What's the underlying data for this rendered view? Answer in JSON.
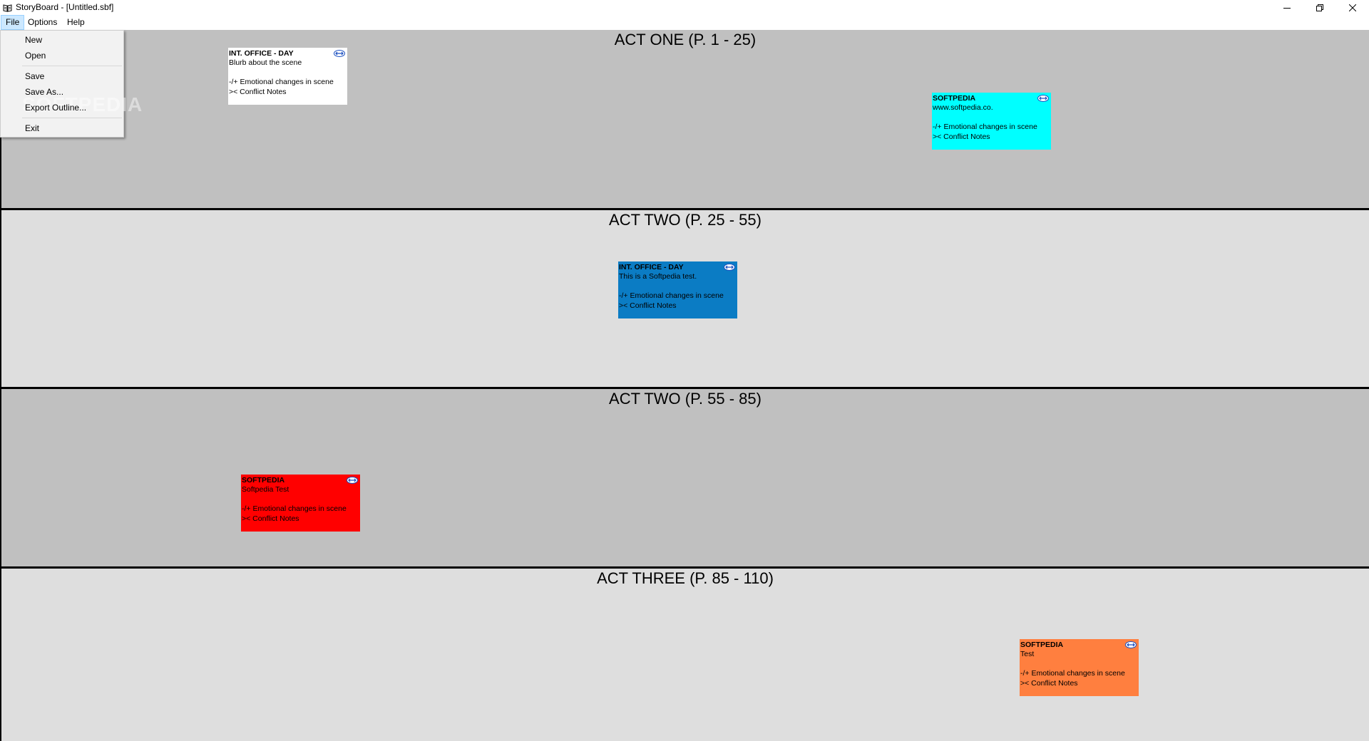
{
  "window": {
    "title": "StoryBoard - [Untitled.sbf]",
    "icon": "book-icon",
    "controls": [
      "minimize-icon",
      "restore-icon",
      "close-icon"
    ]
  },
  "menubar": {
    "file": "File",
    "options": "Options",
    "help": "Help"
  },
  "file_menu": {
    "open_state": "expanded",
    "watermark": "SOFTPEDIA",
    "items": [
      {
        "label": "New"
      },
      {
        "label": "Open"
      },
      {
        "label": "Save"
      },
      {
        "label": "Save As..."
      },
      {
        "label": "Export Outline..."
      },
      {
        "label": "Exit"
      }
    ]
  },
  "acts": [
    {
      "title": "ACT ONE (P. 1 - 25)",
      "shade": "#c0c0c0"
    },
    {
      "title": "ACT TWO (P. 25 - 55)",
      "shade": "#dedede"
    },
    {
      "title": "ACT TWO (P. 55 - 85)",
      "shade": "#c0c0c0"
    },
    {
      "title": "ACT THREE (P. 85 - 110)",
      "shade": "#dedede"
    }
  ],
  "cards": [
    {
      "heading": "INT. OFFICE - DAY",
      "text": "Blurb about the scene",
      "emotion": "-/+ Emotional changes in scene",
      "conflict": ">< Conflict Notes",
      "color": "#ffffff",
      "icon": "arrow-link-icon"
    },
    {
      "heading": "SOFTPEDIA",
      "text": "www.softpedia.co.",
      "emotion": "-/+ Emotional changes in scene",
      "conflict": ">< Conflict Notes",
      "color": "#00ffff",
      "icon": "arrow-link-icon"
    },
    {
      "heading": "INT. OFFICE - DAY",
      "text": "This is a Softpedia test.",
      "emotion": "-/+ Emotional changes in scene",
      "conflict": ">< Conflict Notes",
      "color": "#0b7cc4",
      "icon": "arrow-link-icon"
    },
    {
      "heading": "SOFTPEDIA",
      "text": "Softpedia Test",
      "emotion": "-/+ Emotional changes in scene",
      "conflict": ">< Conflict Notes",
      "color": "#ff0000",
      "icon": "arrow-link-icon"
    },
    {
      "heading": "SOFTPEDIA",
      "text": "Test",
      "emotion": "-/+ Emotional changes in scene",
      "conflict": ">< Conflict Notes",
      "color": "#ff7f3f",
      "icon": "arrow-link-icon"
    }
  ]
}
